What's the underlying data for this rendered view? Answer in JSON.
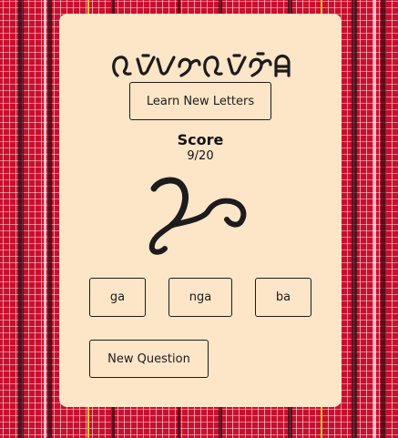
{
  "header": {
    "title_icon": "baybayin-title-script"
  },
  "learn_button": {
    "label": "Learn New Letters"
  },
  "score": {
    "label": "Score",
    "value": "9/20"
  },
  "question": {
    "glyph_icon": "baybayin-character-glyph"
  },
  "options": [
    {
      "label": "ga"
    },
    {
      "label": "nga"
    },
    {
      "label": "ba"
    }
  ],
  "new_question_button": {
    "label": "New Question"
  },
  "colors": {
    "background": "#c8102e",
    "card": "#fde5c8",
    "ink": "#1c1c1c",
    "stripe_yellow": "#f2c21b"
  }
}
